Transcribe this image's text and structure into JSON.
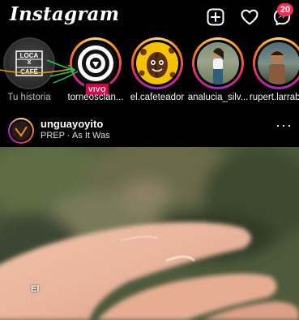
{
  "header": {
    "logo": "Instagram",
    "messages_badge": "20"
  },
  "stories": [
    {
      "label": "Tu historia",
      "own": true,
      "avatar_text_lines": [
        "LOCA",
        "X",
        "CAFÉ"
      ]
    },
    {
      "label": "torneosclan...",
      "live": true,
      "live_label": "VIVO"
    },
    {
      "label": "el.cafeteador"
    },
    {
      "label": "analucia_silv..."
    },
    {
      "label": "rupert.larrab..."
    }
  ],
  "post": {
    "username": "unguayoyito",
    "subtitle": "PREP · As It Was",
    "overlay_text": "El"
  },
  "colors": {
    "background": "#000000",
    "badge": "#ff2d55",
    "live": "#d6004a",
    "annotation_arrow": "#22c55e"
  }
}
